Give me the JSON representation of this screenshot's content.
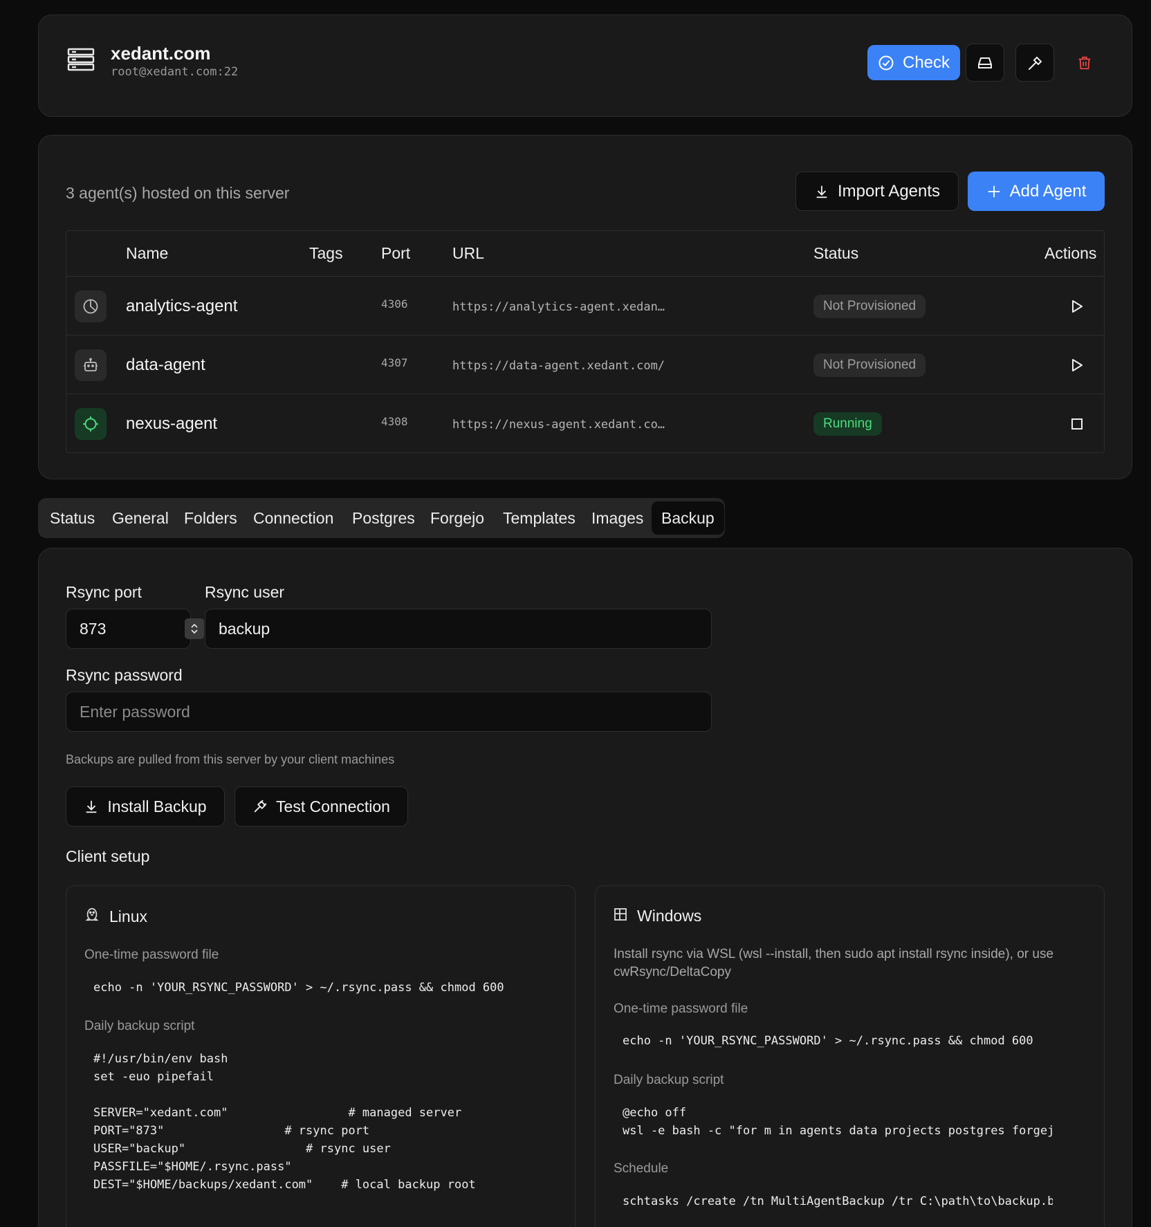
{
  "server": {
    "title": "xedant.com",
    "subtitle": "root@xedant.com:22",
    "check_label": "Check"
  },
  "agents": {
    "count_text": "3 agent(s) hosted on this server",
    "import_label": "Import Agents",
    "add_label": "Add Agent",
    "columns": [
      "Name",
      "Tags",
      "Port",
      "URL",
      "Status",
      "Actions"
    ],
    "rows": [
      {
        "name": "analytics-agent",
        "port": "4306",
        "url": "https://analytics-agent.xedan…",
        "status": "Not Provisioned",
        "icon": "pie-chart-icon",
        "action": "play-icon"
      },
      {
        "name": "data-agent",
        "port": "4307",
        "url": "https://data-agent.xedant.com/",
        "status": "Not Provisioned",
        "icon": "robot-icon",
        "action": "play-icon"
      },
      {
        "name": "nexus-agent",
        "port": "4308",
        "url": "https://nexus-agent.xedant.co…",
        "status": "Running",
        "icon": "crosshair-icon",
        "action": "stop-icon"
      }
    ]
  },
  "tabs": [
    "Status",
    "General",
    "Folders",
    "Connection",
    "Postgres",
    "Forgejo",
    "Templates",
    "Images",
    "Backup"
  ],
  "active_tab": "Backup",
  "backup": {
    "rsync_port_label": "Rsync port",
    "rsync_port_value": "873",
    "rsync_user_label": "Rsync user",
    "rsync_user_value": "backup",
    "rsync_password_label": "Rsync password",
    "rsync_password_placeholder": "Enter password",
    "hint": "Backups are pulled from this server by your client machines",
    "install_label": "Install Backup",
    "test_label": "Test Connection",
    "client_setup_title": "Client setup"
  },
  "linux": {
    "title": "Linux",
    "pw_label": "One-time password file",
    "pw_code": "echo -n 'YOUR_RSYNC_PASSWORD' > ~/.rsync.pass && chmod 600",
    "script_label": "Daily backup script",
    "script_code": "#!/usr/bin/env bash\nset -euo pipefail\n\nSERVER=\"xedant.com\"                 # managed server\nPORT=\"873\"                 # rsync port\nUSER=\"backup\"                 # rsync user\nPASSFILE=\"$HOME/.rsync.pass\"\nDEST=\"$HOME/backups/xedant.com\"    # local backup root"
  },
  "windows": {
    "title": "Windows",
    "desc": "Install rsync via WSL (wsl --install, then sudo apt install rsync inside), or use cwRsync/DeltaCopy",
    "pw_label": "One-time password file",
    "pw_code": "echo -n 'YOUR_RSYNC_PASSWORD' > ~/.rsync.pass && chmod 600",
    "script_label": "Daily backup script",
    "script_code": "@echo off\nwsl -e bash -c \"for m in agents data projects postgres forgejo",
    "schedule_label": "Schedule",
    "schedule_code": "schtasks /create /tn MultiAgentBackup /tr C:\\path\\to\\backup.bat"
  },
  "colors": {
    "accent": "#3b82f6",
    "danger": "#ef4444",
    "running": "#4ade80"
  }
}
